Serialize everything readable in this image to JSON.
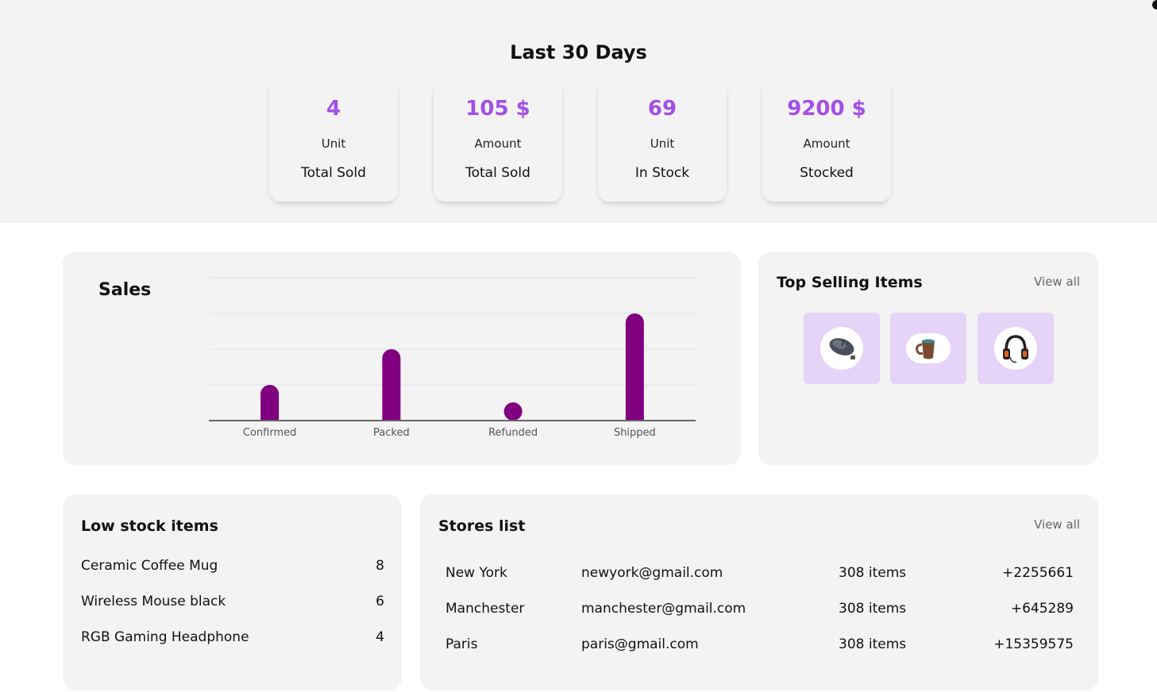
{
  "header": {
    "title": "Last 30 Days"
  },
  "stats": [
    {
      "value": "4",
      "unit": "Unit",
      "label": "Total Sold"
    },
    {
      "value": "105 $",
      "unit": "Amount",
      "label": "Total Sold"
    },
    {
      "value": "69",
      "unit": "Unit",
      "label": "In Stock"
    },
    {
      "value": "9200 $",
      "unit": "Amount",
      "label": "Stocked"
    }
  ],
  "sales": {
    "title": "Sales"
  },
  "chart_data": {
    "type": "bar",
    "title": "Sales",
    "categories": [
      "Confirmed",
      "Packed",
      "Refunded",
      "Shipped"
    ],
    "values": [
      1,
      2,
      0,
      3
    ],
    "ylim": [
      0,
      4
    ],
    "grid": true,
    "bar_color": "#800080"
  },
  "top_selling": {
    "title": "Top Selling Items",
    "view_all": "View all",
    "items": [
      {
        "icon": "mouse-icon"
      },
      {
        "icon": "mug-icon"
      },
      {
        "icon": "headphone-icon"
      }
    ]
  },
  "low_stock": {
    "title": "Low stock items",
    "items": [
      {
        "name": "Ceramic Coffee Mug",
        "count": "8"
      },
      {
        "name": "Wireless Mouse black",
        "count": "6"
      },
      {
        "name": "RGB Gaming Headphone",
        "count": "4"
      }
    ]
  },
  "stores": {
    "title": "Stores list",
    "view_all": "View all",
    "rows": [
      {
        "city": "New York",
        "email": "newyork@gmail.com",
        "items": "308 items",
        "phone": "+2255661"
      },
      {
        "city": "Manchester",
        "email": "manchester@gmail.com",
        "items": "308 items",
        "phone": "+645289"
      },
      {
        "city": "Paris",
        "email": "paris@gmail.com",
        "items": "308 items",
        "phone": "+15359575"
      }
    ]
  },
  "colors": {
    "accent": "#a24fe6",
    "bar": "#800080",
    "tile": "#e6d3f8",
    "panel": "#f3f3f3"
  }
}
